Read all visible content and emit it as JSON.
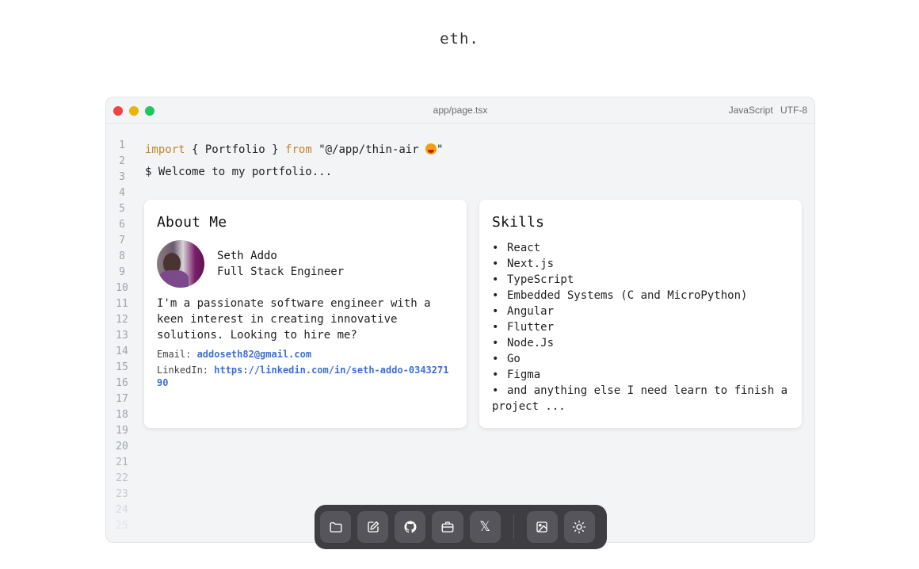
{
  "site": {
    "title": "eth."
  },
  "editor": {
    "filename": "app/page.tsx",
    "language": "JavaScript",
    "encoding": "UTF-8",
    "line_numbers": [
      "1",
      "2",
      "3",
      "4",
      "5",
      "6",
      "7",
      "8",
      "9",
      "10",
      "11",
      "12",
      "13",
      "14",
      "15",
      "16",
      "17",
      "18",
      "19",
      "20",
      "21",
      "22",
      "23",
      "24",
      "25"
    ],
    "code": {
      "import_kw": "import",
      "import_name": "{ Portfolio }",
      "from_kw": "from",
      "import_path": "\"@/app/thin-air ",
      "import_path_end": "\"",
      "prompt": "$ Welcome to my portfolio..."
    }
  },
  "about": {
    "title": "About Me",
    "name": "Seth Addo",
    "role": "Full Stack Engineer",
    "bio": "I'm a passionate software engineer with a keen interest in creating innovative solutions. Looking to hire me?",
    "email_label": "Email: ",
    "email": "addoseth82@gmail.com",
    "linkedin_label": "LinkedIn: ",
    "linkedin": "https://linkedin.com/in/seth-addo-034327190"
  },
  "skills": {
    "title": "Skills",
    "bullet": "•",
    "items": [
      "React",
      "Next.js",
      "TypeScript",
      "Embedded Systems (C and MicroPython)",
      "Angular",
      "Flutter",
      "Node.Js",
      "Go",
      "Figma",
      "and anything else I need learn to finish a project ..."
    ]
  },
  "dock": {
    "items": [
      "folder-icon",
      "edit-icon",
      "github-icon",
      "briefcase-icon",
      "x-icon",
      "image-icon",
      "sun-icon"
    ],
    "x_glyph": "𝕏"
  },
  "colors": {
    "keyword": "#c2852f",
    "link": "#3b6fd8",
    "dock_bg": "#3d3d42",
    "traffic_red": "#ef4444",
    "traffic_yellow": "#eab308",
    "traffic_green": "#22c55e"
  }
}
